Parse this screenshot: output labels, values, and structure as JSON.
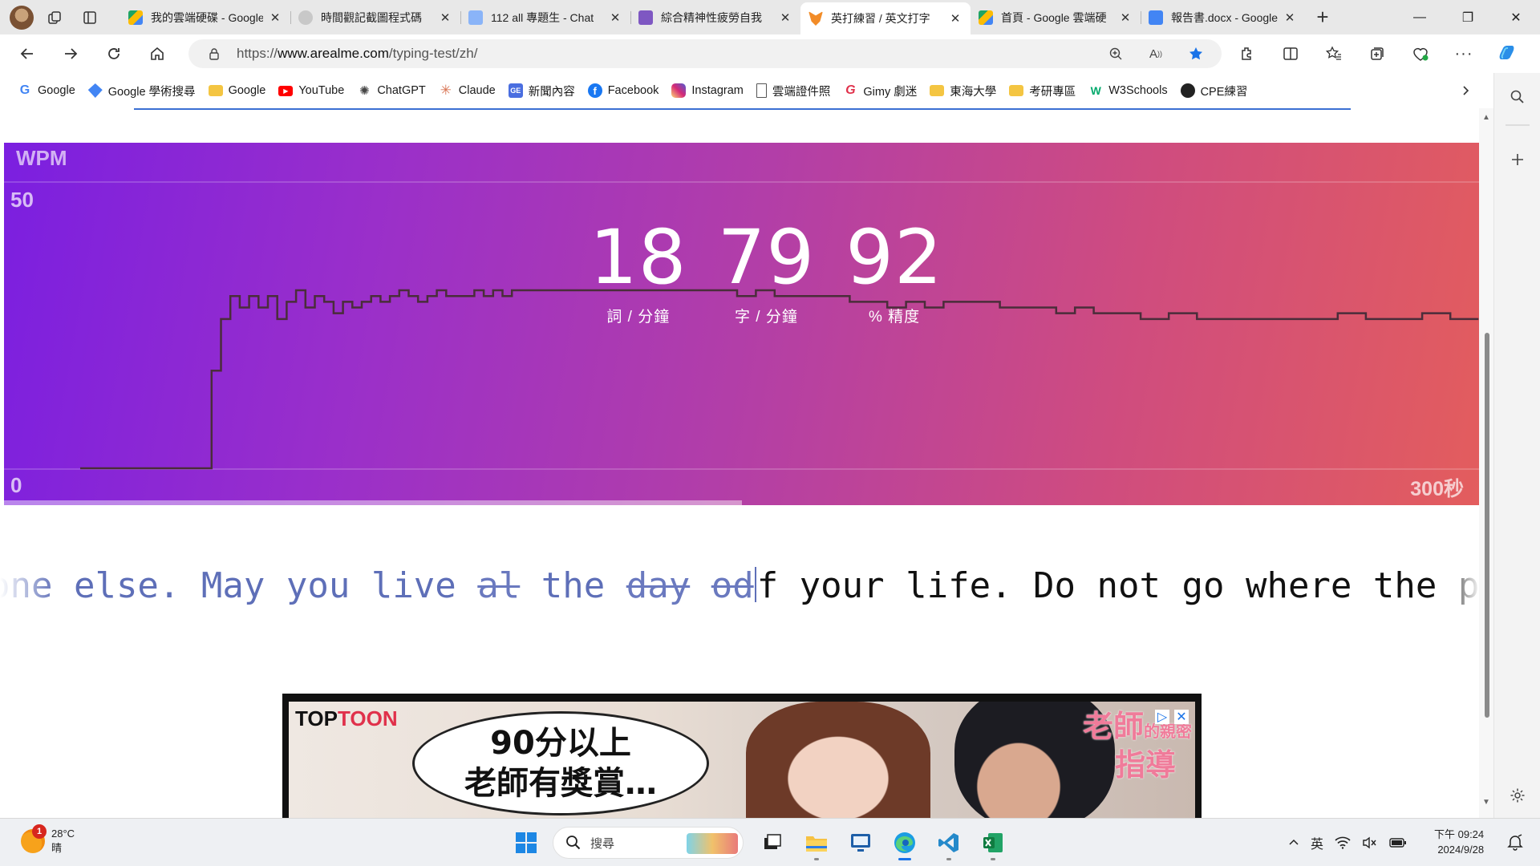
{
  "browser": {
    "tabs": [
      {
        "title": "我的雲端硬碟 - Google",
        "favicon_color": "#1fa463"
      },
      {
        "title": "時間觀記截圖程式碼",
        "favicon_color": "#9aa0a6"
      },
      {
        "title": "112 all 專題生 - Chat",
        "favicon_color": "#8ab4f8"
      },
      {
        "title": "綜合精神性疲勞自我",
        "favicon_color": "#7e57c2"
      },
      {
        "title": "英打練習 / 英文打字",
        "favicon_color": "#f28c28",
        "active": true
      },
      {
        "title": "首頁 - Google 雲端硬",
        "favicon_color": "#fbbc04"
      },
      {
        "title": "報告書.docx - Google",
        "favicon_color": "#4285f4"
      }
    ],
    "url_prefix": "https://",
    "url_domain": "www.arealme.com",
    "url_path": "/typing-test/zh/",
    "bookmarks": [
      {
        "label": "Google",
        "icon": "google-icon",
        "color": "#4285f4"
      },
      {
        "label": "Google 學術搜尋",
        "icon": "scholar-icon",
        "color": "#4285f4"
      },
      {
        "label": "Google",
        "icon": "folder-icon",
        "color": "#f4c542"
      },
      {
        "label": "YouTube",
        "icon": "youtube-icon",
        "color": "#ff0000"
      },
      {
        "label": "ChatGPT",
        "icon": "chatgpt-icon",
        "color": "#444444"
      },
      {
        "label": "Claude",
        "icon": "claude-icon",
        "color": "#d97757"
      },
      {
        "label": "新聞內容",
        "icon": "news-icon",
        "color": "#4a6ee0"
      },
      {
        "label": "Facebook",
        "icon": "facebook-icon",
        "color": "#1877f2"
      },
      {
        "label": "Instagram",
        "icon": "instagram-icon",
        "color": "#d62976"
      },
      {
        "label": "雲端證件照",
        "icon": "page-icon",
        "color": "#666666"
      },
      {
        "label": "Gimy 劇迷",
        "icon": "gimy-icon",
        "color": "#e0314b"
      },
      {
        "label": "東海大學",
        "icon": "folder-icon",
        "color": "#f4c542"
      },
      {
        "label": "考研專區",
        "icon": "folder-icon",
        "color": "#f4c542"
      },
      {
        "label": "W3Schools",
        "icon": "w3schools-icon",
        "color": "#04aa6d"
      },
      {
        "label": "CPE練習",
        "icon": "github-icon",
        "color": "#222222"
      }
    ]
  },
  "test": {
    "wpm_axis_label": "WPM",
    "stats": [
      {
        "value": "18",
        "label": "詞 / 分鐘"
      },
      {
        "value": "79",
        "label": "字 / 分鐘"
      },
      {
        "value": "92",
        "label": "% 精度"
      }
    ],
    "text_done": "one else. May you live ",
    "text_err1": "al",
    "text_mid": " the ",
    "text_err2": "day",
    "text_space": " ",
    "text_err3": "od",
    "text_todo": "f your life. Do not go where the path"
  },
  "chart_data": {
    "type": "line",
    "xlabel": "",
    "ylabel": "WPM",
    "xlim": [
      0,
      300
    ],
    "ylim": [
      0,
      50
    ],
    "x_max_label": "300秒",
    "y_max_label": "50",
    "y_min_label": "0",
    "progress_fraction": 0.5,
    "series": [
      {
        "x": [
          0,
          26,
          28,
          30,
          32,
          34,
          36,
          38,
          40,
          42,
          44,
          46,
          48,
          50,
          52,
          54,
          56,
          58,
          60,
          62,
          64,
          66,
          68,
          70,
          72,
          74,
          76,
          78,
          80,
          82,
          84,
          86,
          88,
          90,
          92,
          94,
          96,
          100,
          104,
          108,
          112,
          116,
          120,
          124,
          128,
          132,
          136,
          140,
          144,
          148,
          152,
          156,
          160,
          164,
          168,
          172,
          176,
          180,
          184,
          188,
          192,
          196,
          200,
          204,
          208,
          212,
          216,
          220,
          226,
          232,
          238,
          244,
          250,
          256,
          262,
          268,
          274,
          280,
          286,
          292,
          298
        ],
        "y": [
          0,
          0,
          17,
          26,
          30,
          28,
          30,
          28,
          30,
          26,
          29,
          31,
          28,
          30,
          29,
          27,
          29,
          28,
          29,
          30,
          29,
          30,
          31,
          30,
          29,
          30,
          31,
          30,
          30,
          30,
          31,
          30,
          31,
          30,
          31,
          31,
          31,
          31,
          31,
          31,
          31,
          31,
          31,
          31,
          31,
          31,
          31,
          30,
          31,
          30,
          30,
          30,
          30,
          29,
          29,
          28,
          29,
          28,
          29,
          29,
          29,
          28,
          28,
          28,
          27,
          28,
          27,
          27,
          26,
          27,
          26,
          26,
          26,
          26,
          26,
          27,
          26,
          26,
          27,
          26,
          26
        ]
      }
    ]
  },
  "ad": {
    "brand_left": "TOP",
    "brand_right": "TOON",
    "bubble_line1": "90分以上",
    "bubble_line2": "老師有獎賞…",
    "title_line1": "老師",
    "title_small": "的親密",
    "title_line2": "指導"
  },
  "taskbar": {
    "temperature": "28°C",
    "weather": "晴",
    "weather_badge": "1",
    "search_placeholder": "搜尋",
    "ime": "英",
    "time": "下午 09:24",
    "date": "2024/9/28"
  }
}
